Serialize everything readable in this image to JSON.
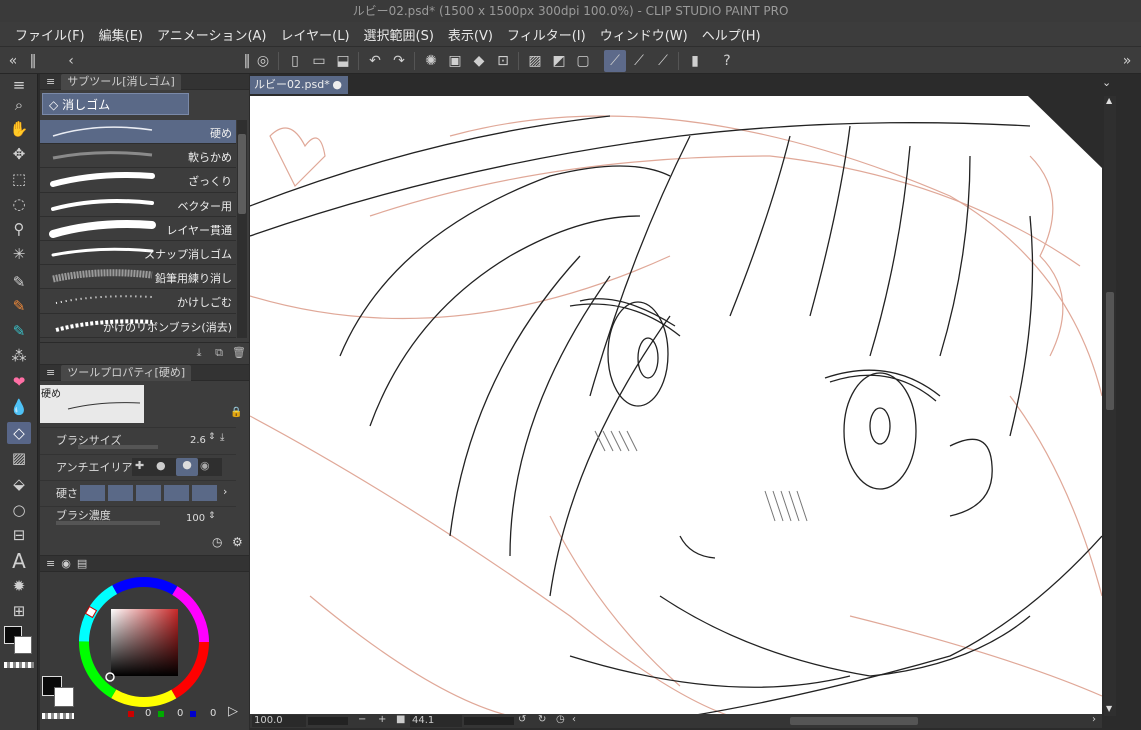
{
  "window": {
    "title": "ルビー02.psd* (1500 x 1500px 300dpi 100.0%)  - CLIP STUDIO PAINT PRO"
  },
  "menu": [
    "ファイル(F)",
    "編集(E)",
    "アニメーション(A)",
    "レイヤー(L)",
    "選択範囲(S)",
    "表示(V)",
    "フィルター(I)",
    "ウィンドウ(W)",
    "ヘルプ(H)"
  ],
  "subtool_panel": {
    "title": "サブツール[消しゴム]",
    "group": "消しゴム",
    "brushes": [
      "硬め",
      "軟らかめ",
      "ざっくり",
      "ベクター用",
      "レイヤー貫通",
      "スナップ消しゴム",
      "鉛筆用練り消し",
      "かけしごむ",
      "かけのリボンブラシ(消去)"
    ],
    "selected_index": 0
  },
  "tool_property": {
    "title": "ツールプロパティ[硬め]",
    "preview_label": "硬め",
    "brush_size_label": "ブラシサイズ",
    "brush_size_value": "2.6",
    "antialias_label": "アンチエイリアス",
    "hardness_label": "硬さ",
    "density_label": "ブラシ濃度",
    "density_value": "100"
  },
  "color": {
    "main": "#0a0a0a",
    "sub": "#ffffff",
    "picker_hue": "#c82828",
    "rgb": [
      "0",
      "0",
      "0"
    ]
  },
  "document": {
    "tab": "ルビー02.psd*"
  },
  "status": {
    "zoom": "100.0",
    "rotation": "44.1"
  }
}
